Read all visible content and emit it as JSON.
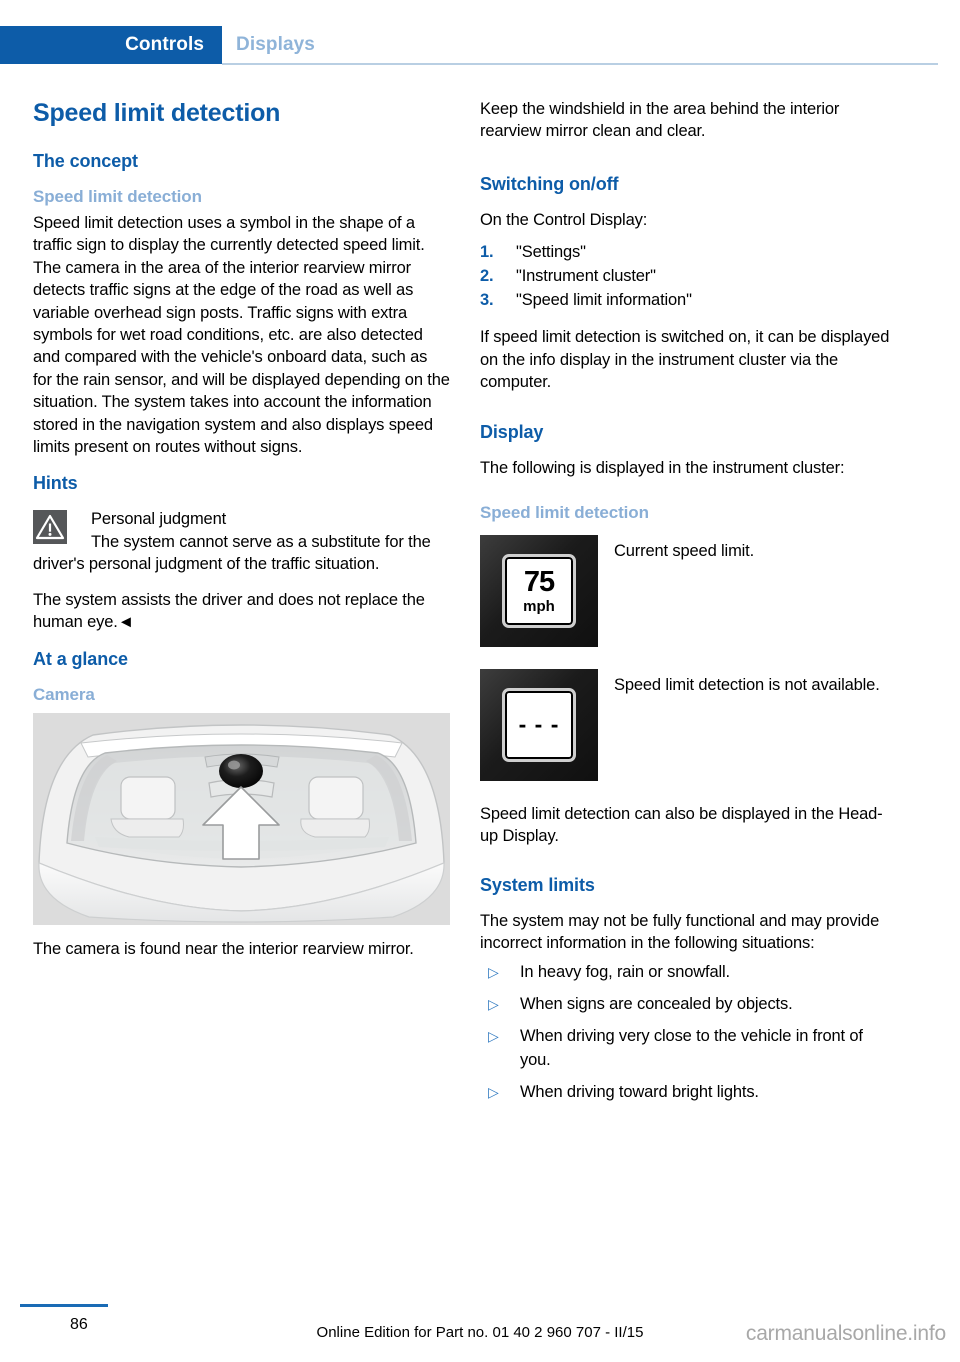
{
  "header": {
    "active_tab": "Controls",
    "inactive_tab": "Displays",
    "accent_color": "#0d5ca8"
  },
  "left_column": {
    "title": "Speed limit detection",
    "concept_heading": "The concept",
    "concept_sub": "Speed limit detection",
    "concept_paragraph": "Speed limit detection uses a symbol in the shape of a traffic sign to display the currently detected speed limit. The camera in the area of the interior rearview mirror detects traffic signs at the edge of the road as well as variable overhead sign posts. Traffic signs with extra symbols for wet road conditions, etc. are also detected and compared with the vehicle's onboard data, such as for the rain sensor, and will be displayed depending on the situation. The system takes into account the information stored in the navigation system and also displays speed limits present on routes without signs.",
    "hints_heading": "Hints",
    "warning_title": "Personal judgment",
    "warning_text": "The system cannot serve as a substitute for the driver's personal judgment of the traffic situation.",
    "warning_text_2": "The system assists the driver and does not replace the human eye.◄",
    "glance_heading": "At a glance",
    "camera_sub": "Camera",
    "camera_caption": "The camera is found near the interior rearview mirror."
  },
  "right_column": {
    "intro_paragraph": "Keep the windshield in the area behind the interior rearview mirror clean and clear.",
    "switching_heading": "Switching on/off",
    "switching_intro": "On the Control Display:",
    "steps": [
      {
        "num": "1.",
        "label": "\"Settings\""
      },
      {
        "num": "2.",
        "label": "\"Instrument cluster\""
      },
      {
        "num": "3.",
        "label": "\"Speed limit information\""
      }
    ],
    "switching_note": "If speed limit detection is switched on, it can be displayed on the info display in the instrument cluster via the computer.",
    "display_heading": "Display",
    "display_intro": "The following is displayed in the instrument cluster:",
    "display_sub": "Speed limit detection",
    "display_items": [
      {
        "icon": "speed-limit-sign-75-mph",
        "sign_value": "75",
        "sign_unit": "mph",
        "label": "Current speed limit."
      },
      {
        "icon": "speed-limit-sign-unavailable",
        "sign_value": "- - -",
        "sign_unit": "",
        "label": "Speed limit detection is not available."
      }
    ],
    "hud_note": "Speed limit detection can also be displayed in the Head-up Display.",
    "limits_heading": "System limits",
    "limits_intro": "The system may not be fully functional and may provide incorrect information in the following situations:",
    "limits_bullets": [
      "In heavy fog, rain or snowfall.",
      "When signs are concealed by objects.",
      "When driving very close to the vehicle in front of you.",
      "When driving toward bright lights."
    ]
  },
  "footer": {
    "page_number": "86",
    "edition_text": "Online Edition for Part no. 01 40 2 960 707 - II/15",
    "watermark": "carmanualsonline.info"
  }
}
